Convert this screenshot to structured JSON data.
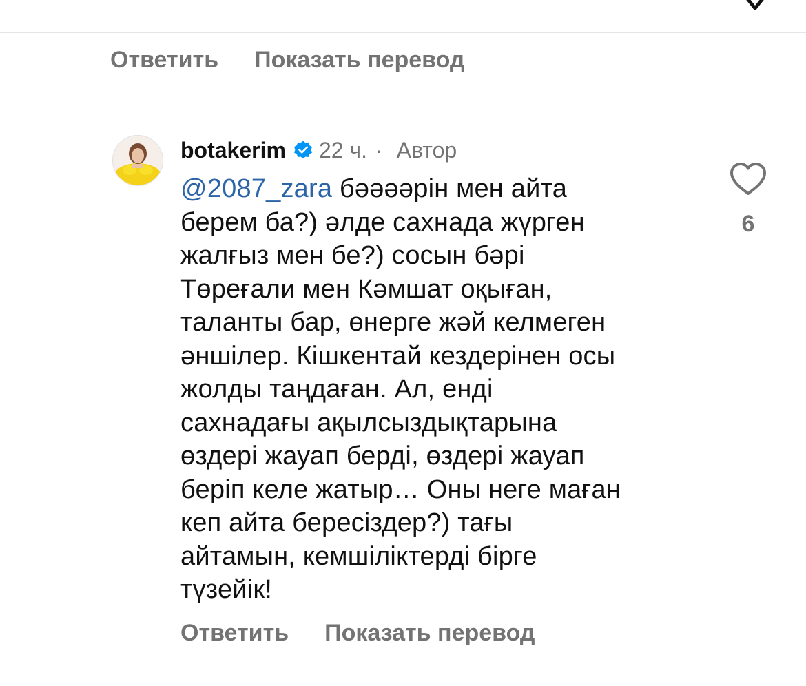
{
  "previous_comment": {
    "reply_label": "Ответить",
    "translate_label": "Показать перевод"
  },
  "comment": {
    "username": "botakerim",
    "verified": true,
    "time": "22 ч.",
    "separator": "·",
    "author_badge": "Автор",
    "mention": "@2087_zara",
    "text_lines": [
      " бәәәәрін мен айта",
      "берем ба?) әлде сахнада жүрген",
      "жалғыз мен бе?) сосын бәрі",
      "Төреғали мен Кәмшат оқыған,",
      "таланты бар, өнерге жәй келмеген",
      "әншілер. Кішкентай кездерінен осы",
      "жолды таңдаған. Ал, енді",
      "сахнадағы ақылсыздықтарына",
      "өздері жауап берді, өздері жауап",
      "беріп келе жатыр… Оны неге маған",
      "кеп айта бересіздер?) тағы",
      "айтамын, кемшіліктерді бірге",
      "түзейік!"
    ],
    "like_count": "6",
    "reply_label": "Ответить",
    "translate_label": "Показать перевод"
  },
  "icons": {
    "verified": "verified-badge-icon",
    "like": "heart-outline-icon",
    "chevron": "chevron-down-icon"
  },
  "colors": {
    "muted_text": "#737373",
    "mention_link": "#2c64a8",
    "verified_badge": "#0095f6",
    "primary_text": "#111111"
  }
}
